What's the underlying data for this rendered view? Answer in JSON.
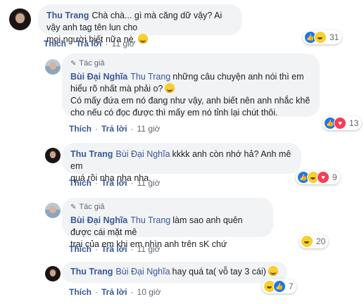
{
  "comments": [
    {
      "name": "Thu Trang",
      "text": "Chà chà... gì mà căng dữ vậy? Ai vậy anh tag tên lun cho",
      "text2": "mọi người biết nữa nè.",
      "reactions": {
        "icons": [
          "like-icon",
          "haha-icon"
        ],
        "count": "31"
      },
      "actions": {
        "like": "Thích",
        "reply": "Trả lời",
        "time": "11 giờ"
      }
    },
    {
      "author_tag": "Tác giả",
      "name": "Bùi Đại Nghĩa",
      "tagged": "Thu Trang",
      "text": "những câu chuyện anh nói thì em",
      "text2": "hiểu rõ nhất mà phải o?",
      "text3": "Có mấy đứa em nó đang như vậy, anh biết nên anh nhắc khẽ",
      "text4": "cho nếu có đọc được thì mấy em nó tỉnh lại chút thôi.",
      "reactions": {
        "icons": [
          "like-icon",
          "love-icon"
        ],
        "count": "13"
      },
      "actions": {
        "like": "Thích",
        "reply": "Trả lời",
        "time": "11 giờ"
      }
    },
    {
      "name": "Thu Trang",
      "tagged": "Bùi Đại Nghĩa",
      "text": "kkkk anh còn nhớ hả? Anh mê em",
      "text2": "quá rồi nha nha nha.",
      "reactions": {
        "icons": [
          "like-icon",
          "haha-icon",
          "love-icon"
        ],
        "count": "9"
      },
      "actions": {
        "like": "Thích",
        "reply": "Trả lời",
        "time": "11 giờ"
      }
    },
    {
      "author_tag": "Tác giả",
      "name": "Bùi Đại Nghĩa",
      "tagged": "Thu Trang",
      "text": "làm sao anh quên được cái mặt mê",
      "text2": "trai của em khi em nhìn anh trên sK chứ",
      "reactions": {
        "icons": [
          "haha-icon"
        ],
        "count": "20"
      },
      "actions": {
        "like": "Thích",
        "reply": "Trả lời",
        "time": "11 giờ"
      }
    },
    {
      "name": "Thu Trang",
      "tagged": "Bùi Đại Nghĩa",
      "text": "hay quá ta( vỗ tay 3 cái)",
      "reactions": {
        "icons": [
          "haha-icon",
          "like-icon"
        ],
        "count": "7"
      },
      "actions": {
        "like": "Thích",
        "reply": "Trả lời",
        "time": "10 giờ"
      }
    }
  ],
  "colors": {
    "link": "#385898",
    "bubble": "#f2f3f5",
    "meta": "#606770"
  }
}
